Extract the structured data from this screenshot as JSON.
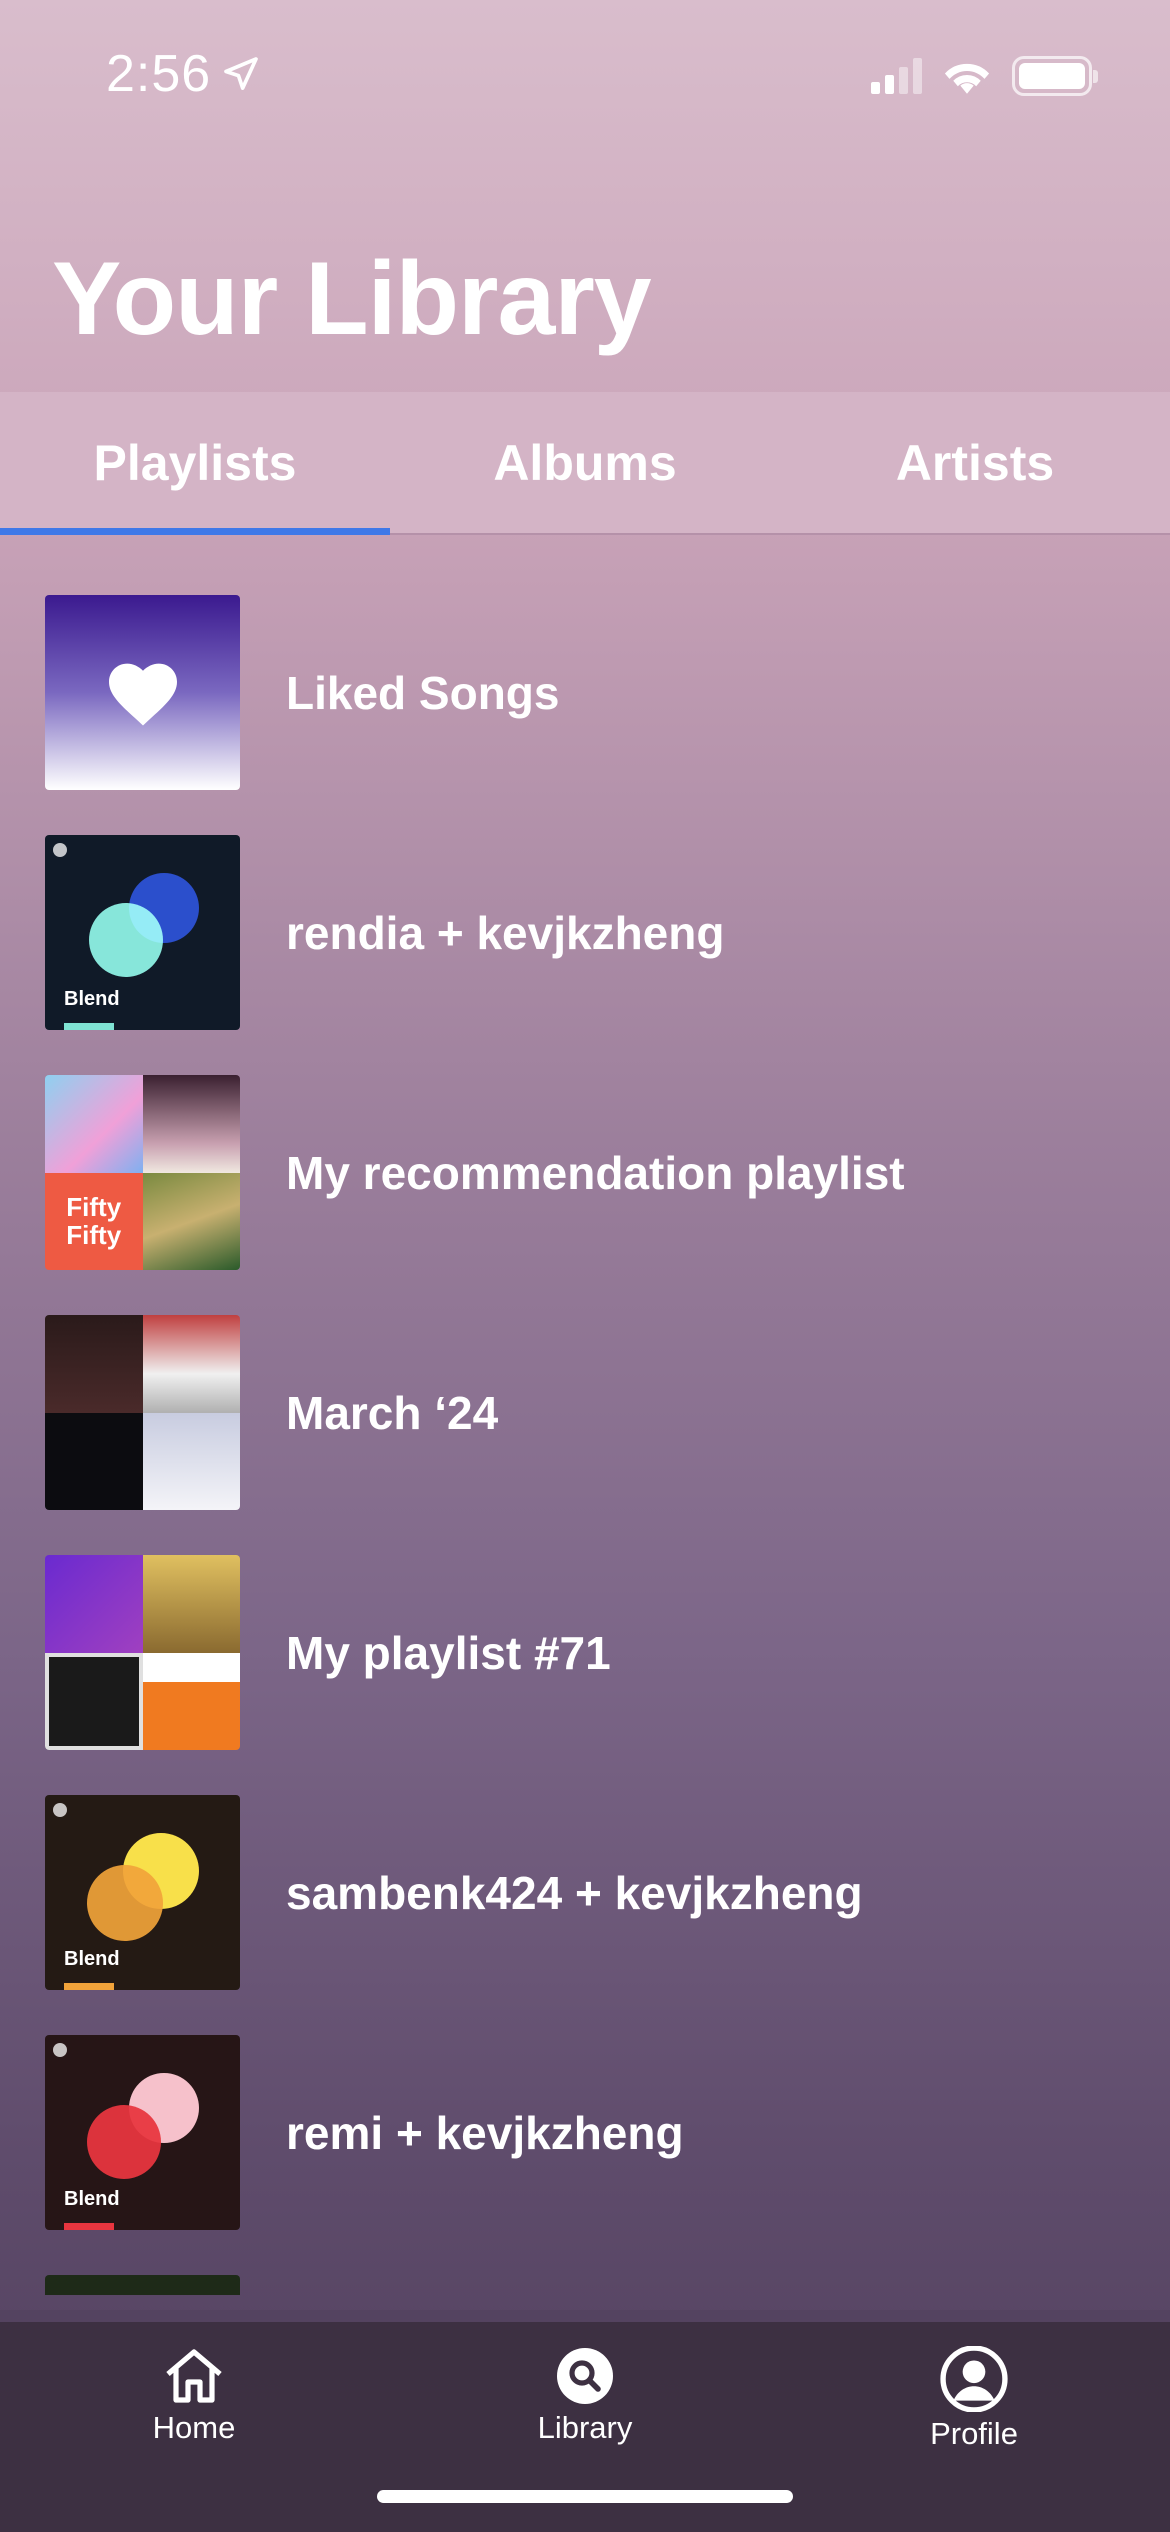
{
  "status_bar": {
    "time": "2:56",
    "location_icon": "location-arrow-icon",
    "signal_icon": "cellular-signal-icon",
    "wifi_icon": "wifi-icon",
    "battery_icon": "battery-icon"
  },
  "page": {
    "title": "Your Library"
  },
  "tabs": [
    {
      "label": "Playlists",
      "active": true
    },
    {
      "label": "Albums",
      "active": false
    },
    {
      "label": "Artists",
      "active": false
    }
  ],
  "playlists": [
    {
      "title": "Liked Songs",
      "cover": "liked-songs-heart"
    },
    {
      "title": "rendia + kevjkzheng",
      "cover": "blend",
      "cover_label": "Blend",
      "colors": [
        "#7fe3d3",
        "#2b4fcc"
      ]
    },
    {
      "title": "My recommendation playlist",
      "cover": "mosaic",
      "cover_text": "Fifty Fifty"
    },
    {
      "title": "March ‘24",
      "cover": "mosaic"
    },
    {
      "title": "My playlist #71",
      "cover": "mosaic"
    },
    {
      "title": "sambenk424 + kevjkzheng",
      "cover": "blend",
      "cover_label": "Blend",
      "colors": [
        "#f1a33a",
        "#f8e04a"
      ]
    },
    {
      "title": "remi + kevjkzheng",
      "cover": "blend",
      "cover_label": "Blend",
      "colors": [
        "#e8353f",
        "#f6c1cb"
      ]
    }
  ],
  "bottom_nav": [
    {
      "label": "Home",
      "icon": "home-icon",
      "active": false
    },
    {
      "label": "Library",
      "icon": "search-icon",
      "active": true
    },
    {
      "label": "Profile",
      "icon": "profile-icon",
      "active": false
    }
  ],
  "colors": {
    "tab_indicator": "#3f78e8",
    "nav_background": "#3d3042"
  }
}
